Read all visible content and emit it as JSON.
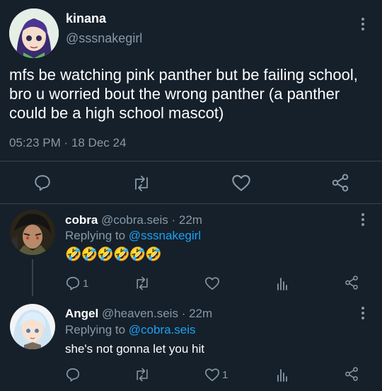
{
  "main_tweet": {
    "display_name": "kinana",
    "handle": "@sssnakegirl",
    "text": "mfs be watching pink panther but be failing school, bro u worried bout the wrong panther (a panther could be a high school mascot)",
    "time": "05:23 PM",
    "separator": "·",
    "date": "18 Dec 24"
  },
  "replies": [
    {
      "display_name": "cobra",
      "handle": "@cobra.seis",
      "time_ago": "· 22m",
      "replying_label": "Replying to",
      "replying_to": "@sssnakegirl",
      "text": "🤣🤣🤣🤣🤣🤣",
      "reply_count": "1",
      "like_count": ""
    },
    {
      "display_name": "Angel",
      "handle": "@heaven.seis",
      "time_ago": "· 22m",
      "replying_label": "Replying to",
      "replying_to": "@cobra.seis",
      "text": "she's not gonna let you hit",
      "reply_count": "",
      "like_count": "1"
    }
  ],
  "colors": {
    "background": "#15202b",
    "muted": "#8899a6",
    "link": "#1da1f2",
    "divider": "#38444d"
  }
}
